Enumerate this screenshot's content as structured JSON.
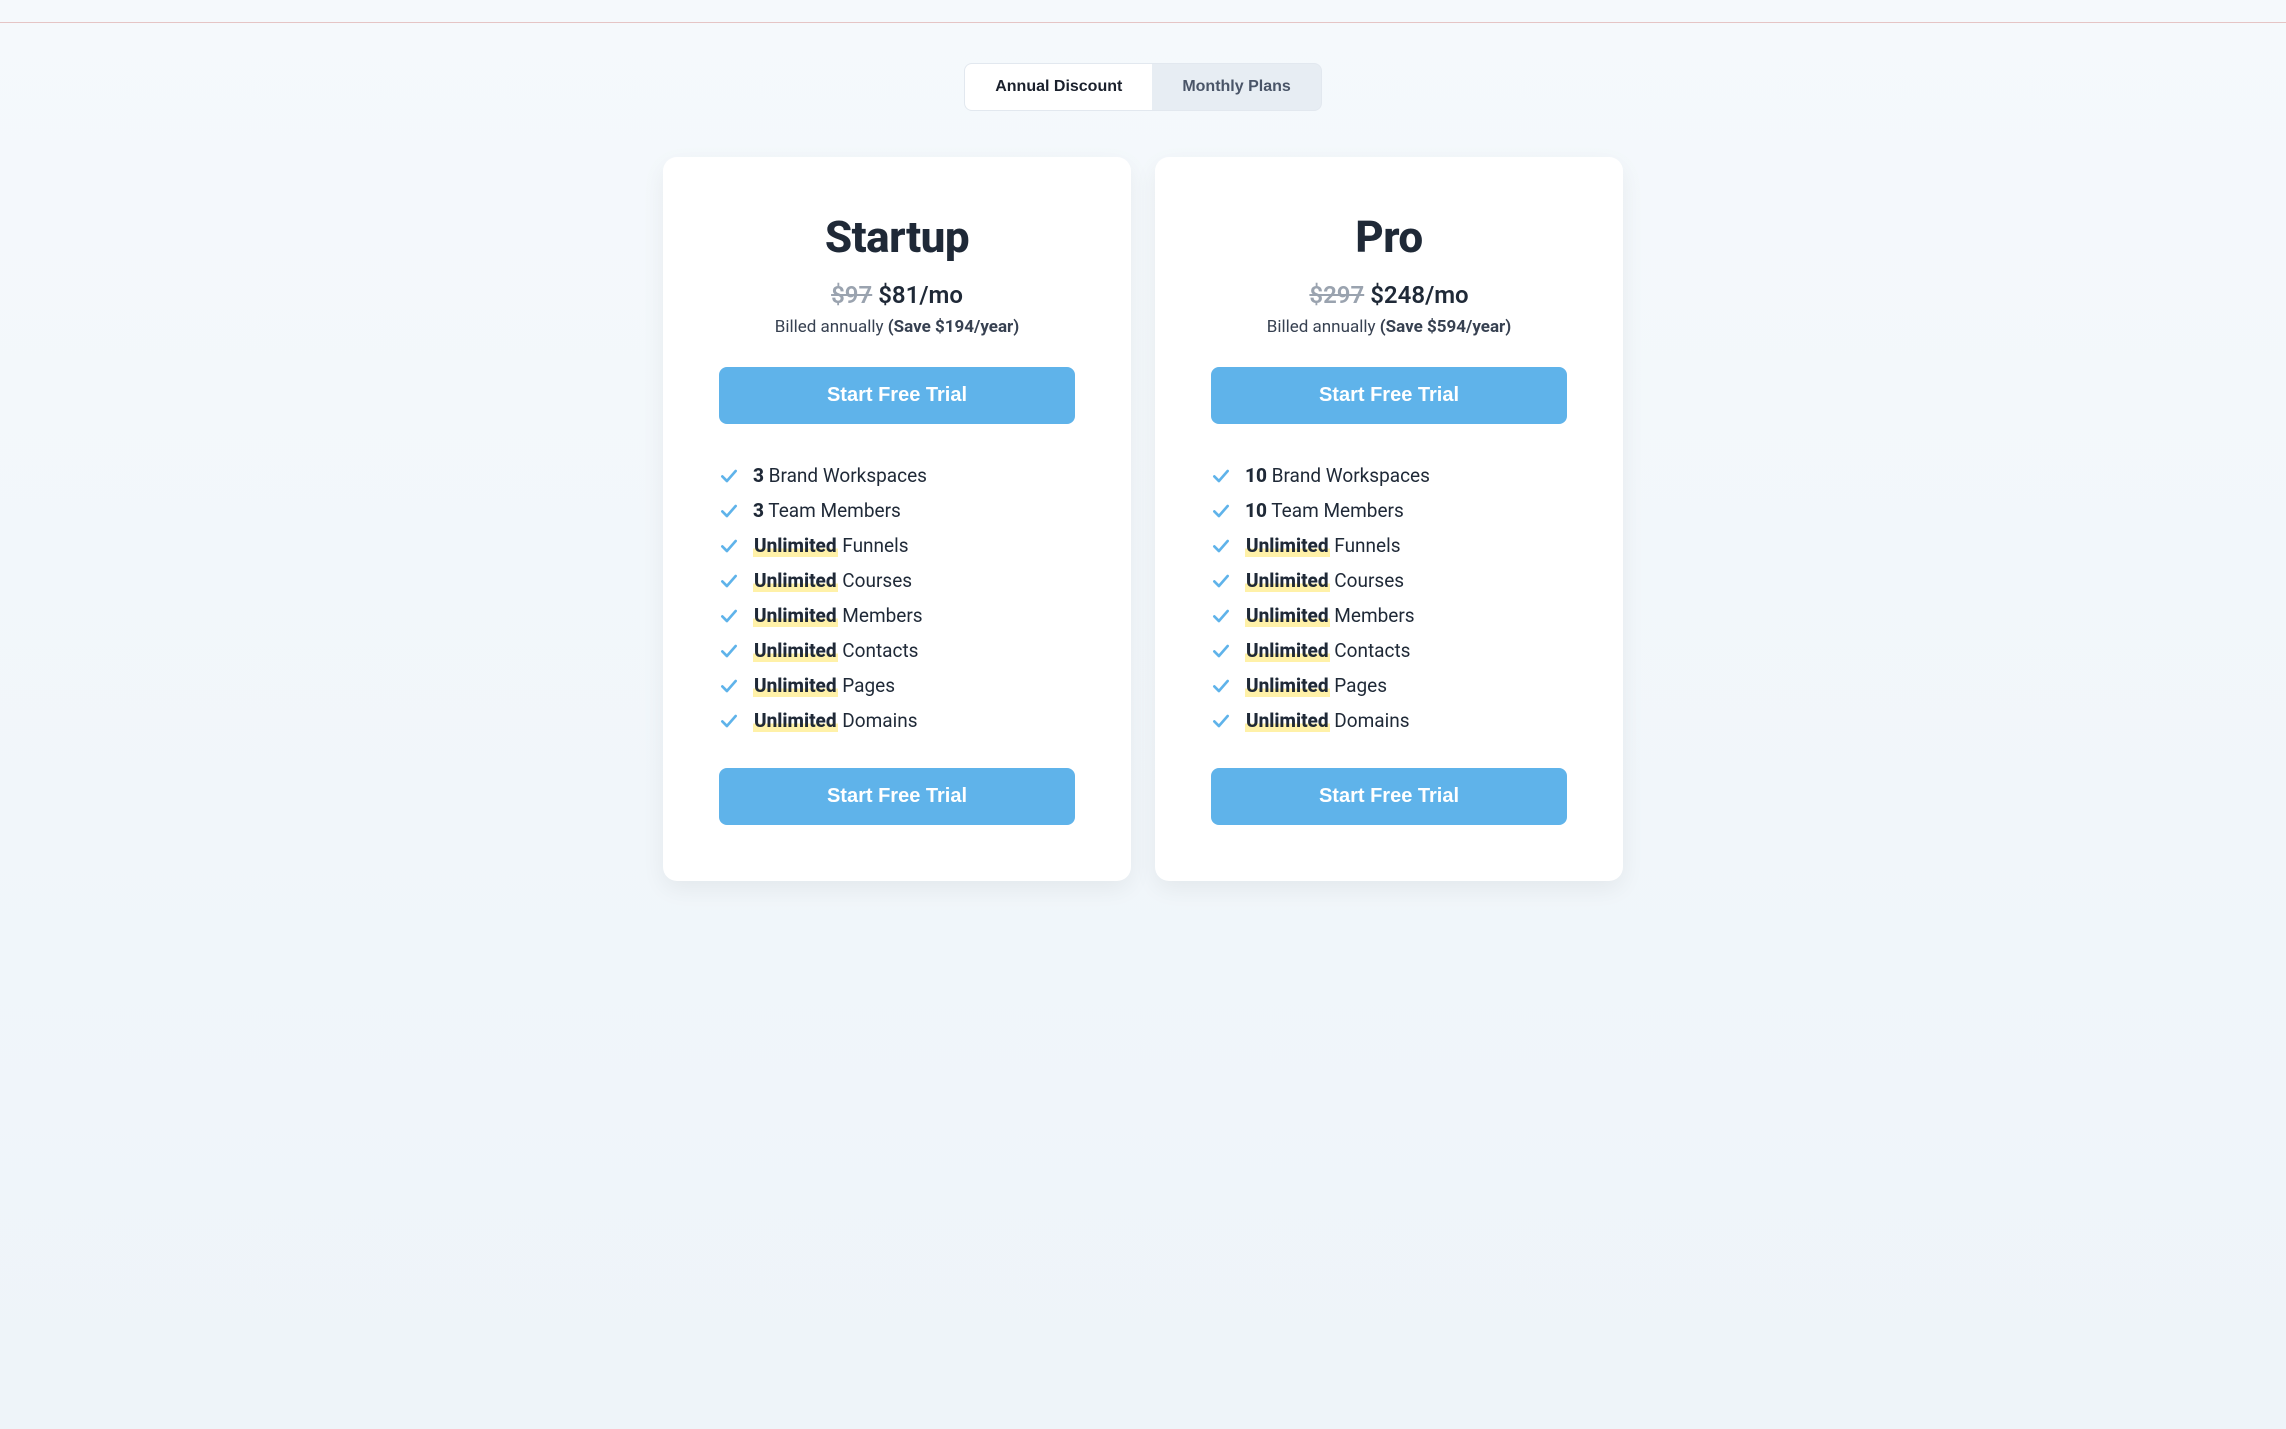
{
  "toggle": {
    "annual_label": "Annual Discount",
    "monthly_label": "Monthly Plans",
    "active": "annual"
  },
  "plans": [
    {
      "name": "Startup",
      "original_price": "$97",
      "price": "$81/mo",
      "billed_prefix": "Billed annually ",
      "save_text": "(Save $194/year)",
      "cta_label": "Start Free Trial",
      "features": [
        {
          "emph": "3",
          "emph_hl": false,
          "rest": " Brand Workspaces"
        },
        {
          "emph": "3",
          "emph_hl": false,
          "rest": " Team Members"
        },
        {
          "emph": "Unlimited",
          "emph_hl": true,
          "rest": " Funnels"
        },
        {
          "emph": "Unlimited",
          "emph_hl": true,
          "rest": " Courses"
        },
        {
          "emph": "Unlimited",
          "emph_hl": true,
          "rest": " Members"
        },
        {
          "emph": "Unlimited",
          "emph_hl": true,
          "rest": " Contacts"
        },
        {
          "emph": "Unlimited",
          "emph_hl": true,
          "rest": " Pages"
        },
        {
          "emph": "Unlimited",
          "emph_hl": true,
          "rest": " Domains"
        }
      ]
    },
    {
      "name": "Pro",
      "original_price": "$297",
      "price": "$248/mo",
      "billed_prefix": "Billed annually ",
      "save_text": "(Save $594/year)",
      "cta_label": "Start Free Trial",
      "features": [
        {
          "emph": "10",
          "emph_hl": false,
          "rest": " Brand Workspaces"
        },
        {
          "emph": "10",
          "emph_hl": false,
          "rest": " Team Members"
        },
        {
          "emph": "Unlimited",
          "emph_hl": true,
          "rest": " Funnels"
        },
        {
          "emph": "Unlimited",
          "emph_hl": true,
          "rest": " Courses"
        },
        {
          "emph": "Unlimited",
          "emph_hl": true,
          "rest": " Members"
        },
        {
          "emph": "Unlimited",
          "emph_hl": true,
          "rest": " Contacts"
        },
        {
          "emph": "Unlimited",
          "emph_hl": true,
          "rest": " Pages"
        },
        {
          "emph": "Unlimited",
          "emph_hl": true,
          "rest": " Domains"
        }
      ]
    }
  ]
}
